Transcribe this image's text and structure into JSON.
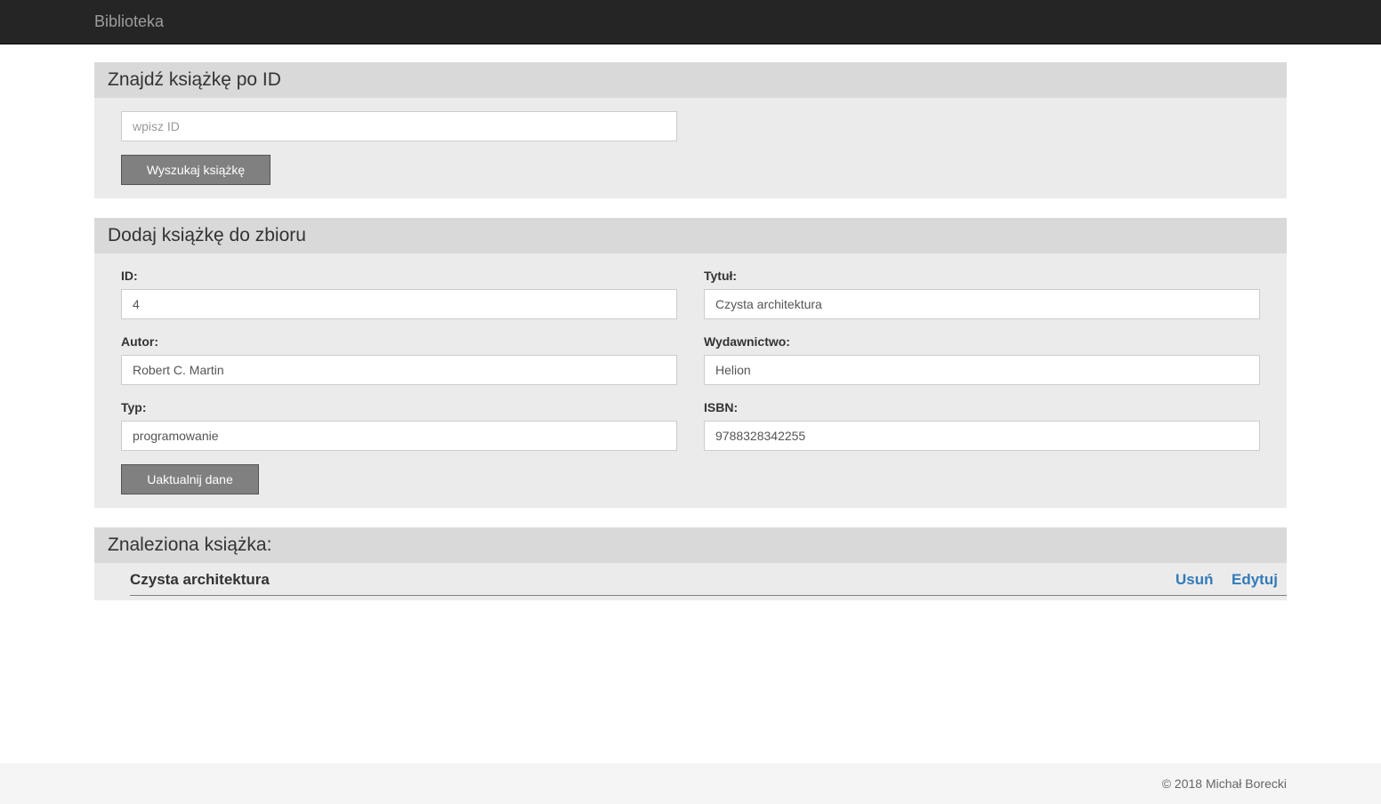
{
  "navbar": {
    "brand": "Biblioteka"
  },
  "search_panel": {
    "heading": "Znajdź książkę po ID",
    "id_placeholder": "wpisz ID",
    "id_value": "",
    "search_button": "Wyszukaj książkę"
  },
  "add_panel": {
    "heading": "Dodaj książkę do zbioru",
    "fields": {
      "id": {
        "label": "ID:",
        "value": "4"
      },
      "title": {
        "label": "Tytuł:",
        "value": "Czysta architektura"
      },
      "author": {
        "label": "Autor:",
        "value": "Robert C. Martin"
      },
      "publisher": {
        "label": "Wydawnictwo:",
        "value": "Helion"
      },
      "type": {
        "label": "Typ:",
        "value": "programowanie"
      },
      "isbn": {
        "label": "ISBN:",
        "value": "9788328342255"
      }
    },
    "update_button": "Uaktualnij dane"
  },
  "found_panel": {
    "heading": "Znaleziona książka:",
    "book_title": "Czysta architektura",
    "delete_link": "Usuń",
    "edit_link": "Edytuj"
  },
  "footer": {
    "copyright": "© 2018 Michał Borecki"
  },
  "colors": {
    "navbar_bg": "#252525",
    "panel_heading_bg": "#d9d9d9",
    "panel_body_bg": "#ebebeb",
    "button_bg": "#808080",
    "link": "#337ab7"
  }
}
